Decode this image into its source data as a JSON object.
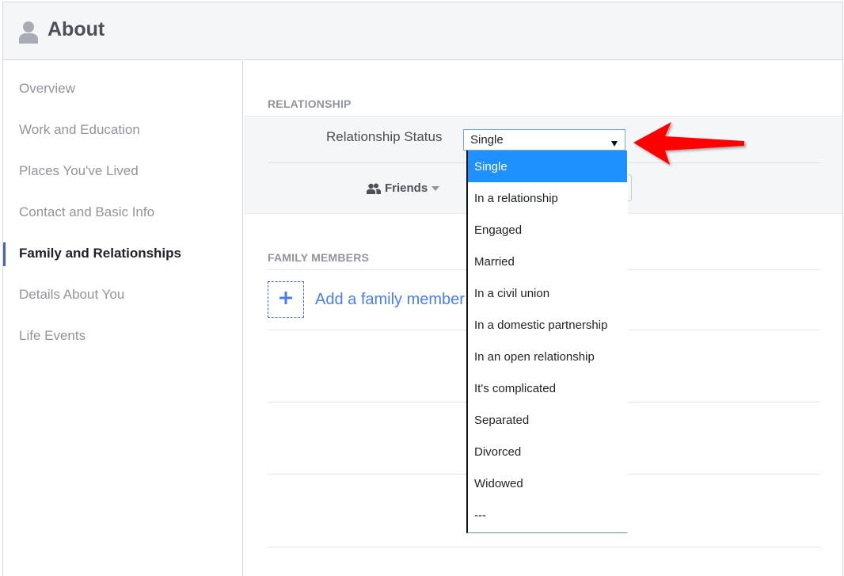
{
  "header": {
    "title": "About",
    "icon": "user-silhouette-icon"
  },
  "sidebar": {
    "items": [
      {
        "label": "Overview",
        "active": false
      },
      {
        "label": "Work and Education",
        "active": false
      },
      {
        "label": "Places You've Lived",
        "active": false
      },
      {
        "label": "Contact and Basic Info",
        "active": false
      },
      {
        "label": "Family and Relationships",
        "active": true
      },
      {
        "label": "Details About You",
        "active": false
      },
      {
        "label": "Life Events",
        "active": false
      }
    ]
  },
  "relationship": {
    "section_title": "RELATIONSHIP",
    "field_label": "Relationship Status",
    "select": {
      "value": "Single",
      "arrow_icon": "triangle-down-icon"
    },
    "options": [
      "Single",
      "In a relationship",
      "Engaged",
      "Married",
      "In a civil union",
      "In a domestic partnership",
      "In an open relationship",
      "It's complicated",
      "Separated",
      "Divorced",
      "Widowed",
      "---"
    ],
    "highlighted_option": "Single",
    "privacy": {
      "label": "Friends",
      "icon": "friends-icon",
      "caret_icon": "caret-down-icon"
    }
  },
  "family": {
    "section_title": "FAMILY MEMBERS",
    "add_label": "Add a family member",
    "add_icon": "plus-icon"
  },
  "annotation": {
    "type": "arrow",
    "color": "#ff0000",
    "points_to": "relationship-status-select"
  },
  "colors": {
    "accent": "#4267b2",
    "link": "#4a7ef0",
    "option_highlight": "#1e90ff",
    "header_bg": "#f5f6f7"
  }
}
